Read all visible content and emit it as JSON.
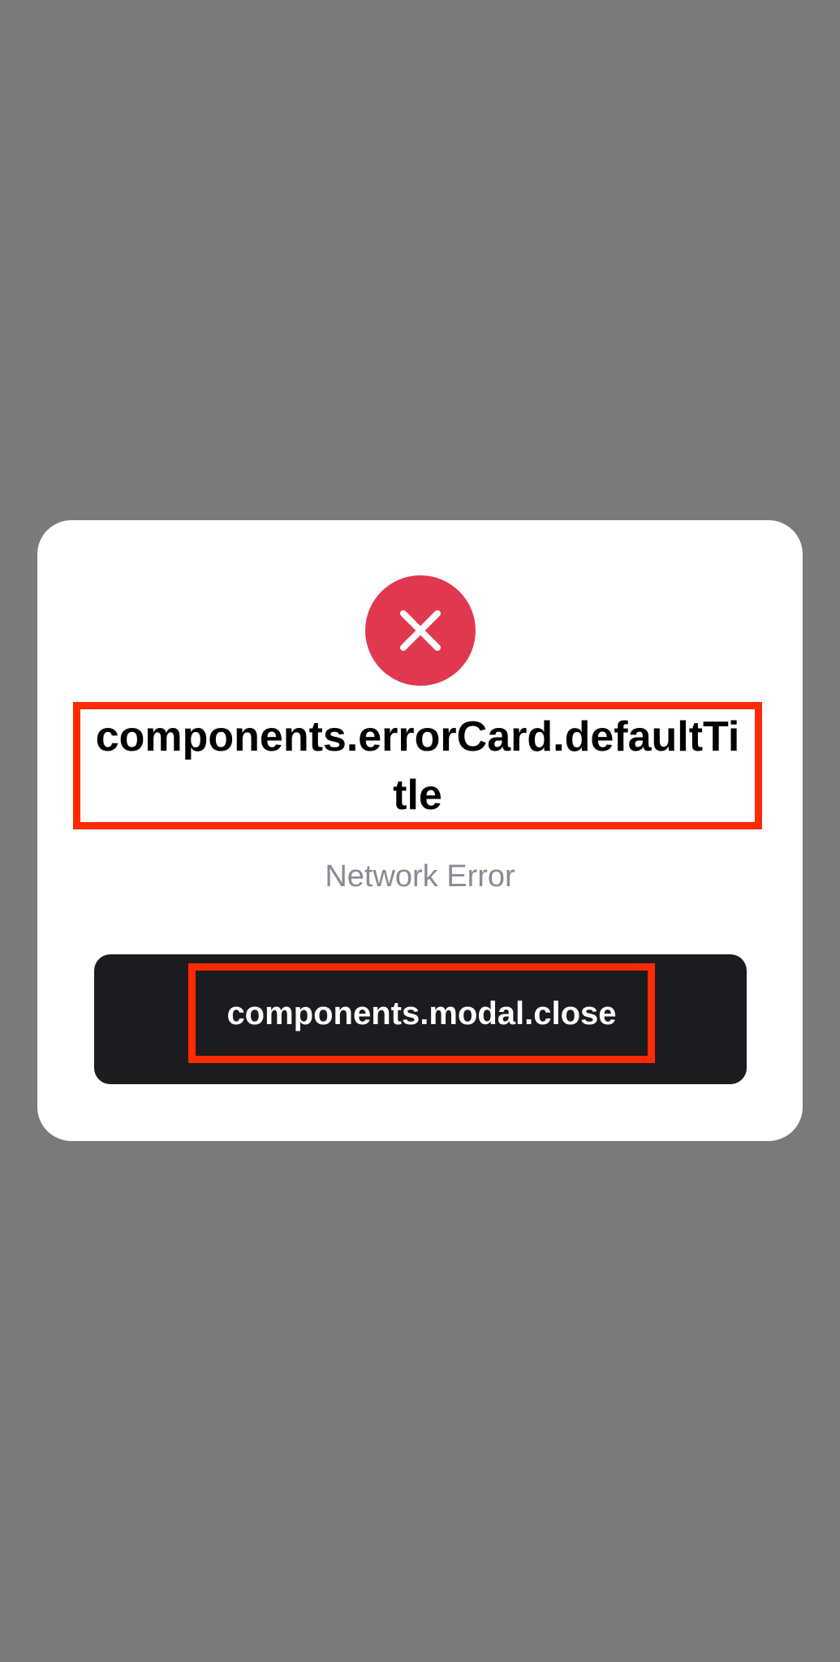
{
  "colors": {
    "backdrop": "#7a7a7a",
    "modal_background": "#ffffff",
    "error_icon_background": "#e0384f",
    "error_icon_glyph": "#ffffff",
    "title_text": "#000000",
    "subtitle_text": "#8a8a96",
    "button_background": "#1c1b20",
    "button_text": "#ffffff",
    "highlight_outline": "#ff2a00"
  },
  "modal": {
    "icon": "close-icon",
    "title": "components.errorCard.defaultTitle",
    "message": "Network Error",
    "close_button_label": "components.modal.close"
  }
}
